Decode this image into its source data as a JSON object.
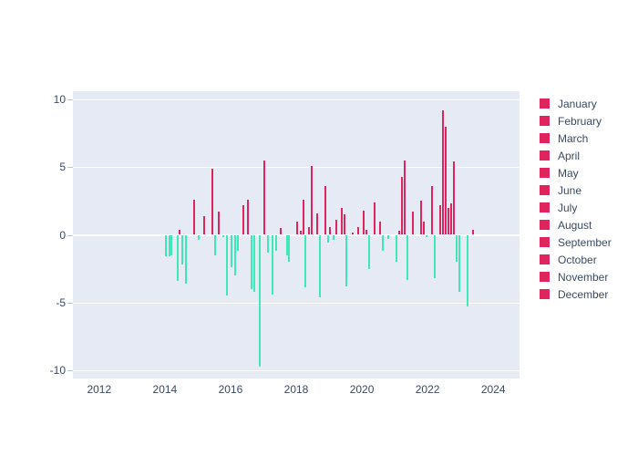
{
  "chart_data": {
    "type": "bar",
    "title": "",
    "xlabel": "",
    "ylabel": "",
    "xlim": [
      2011.2,
      2024.8
    ],
    "ylim": [
      -10.6,
      10.6
    ],
    "grid": true,
    "legend_position": "right",
    "xticks": [
      "2012",
      "2014",
      "2016",
      "2018",
      "2020",
      "2022",
      "2024"
    ],
    "xtick_values": [
      2012,
      2014,
      2016,
      2018,
      2020,
      2022,
      2024
    ],
    "yticks": [
      "10",
      "5",
      "0",
      "-5",
      "-10"
    ],
    "ytick_values": [
      10,
      5,
      0,
      -5,
      -10
    ],
    "positive_color": "#e0245e",
    "negative_color": "#3fe8b6",
    "plot_bgcolor": "#e5eaf4",
    "paper_bgcolor": "#ffffff",
    "tick_font_color": "#3b4a63",
    "series": [
      {
        "name": "January",
        "color": "#e0245e"
      },
      {
        "name": "February",
        "color": "#e0245e"
      },
      {
        "name": "March",
        "color": "#e0245e"
      },
      {
        "name": "April",
        "color": "#e0245e"
      },
      {
        "name": "May",
        "color": "#e0245e"
      },
      {
        "name": "June",
        "color": "#e0245e"
      },
      {
        "name": "July",
        "color": "#e0245e"
      },
      {
        "name": "August",
        "color": "#e0245e"
      },
      {
        "name": "September",
        "color": "#e0245e"
      },
      {
        "name": "October",
        "color": "#e0245e"
      },
      {
        "name": "November",
        "color": "#e0245e"
      },
      {
        "name": "December",
        "color": "#e0245e"
      }
    ],
    "x": [
      2014.04,
      2014.13,
      2014.21,
      2014.29,
      2014.38,
      2014.46,
      2014.54,
      2014.63,
      2014.71,
      2014.79,
      2014.88,
      2014.96,
      2015.04,
      2015.13,
      2015.21,
      2015.29,
      2015.38,
      2015.46,
      2015.54,
      2015.63,
      2015.71,
      2015.79,
      2015.88,
      2015.96,
      2016.04,
      2016.13,
      2016.21,
      2016.29,
      2016.38,
      2016.46,
      2016.54,
      2016.63,
      2016.71,
      2016.79,
      2016.88,
      2016.96,
      2017.04,
      2017.13,
      2017.21,
      2017.29,
      2017.38,
      2017.46,
      2017.54,
      2017.63,
      2017.71,
      2017.79,
      2017.88,
      2017.96,
      2018.04,
      2018.13,
      2018.21,
      2018.29,
      2018.38,
      2018.46,
      2018.54,
      2018.63,
      2018.71,
      2018.79,
      2018.88,
      2018.96,
      2019.04,
      2019.13,
      2019.21,
      2019.29,
      2019.38,
      2019.46,
      2019.54,
      2019.63,
      2019.71,
      2019.79,
      2019.88,
      2019.96,
      2020.04,
      2020.13,
      2020.21,
      2020.29,
      2020.38,
      2020.46,
      2020.54,
      2020.63,
      2020.71,
      2020.79,
      2020.88,
      2020.96,
      2021.04,
      2021.13,
      2021.21,
      2021.29,
      2021.38,
      2021.46,
      2021.54,
      2021.63,
      2021.71,
      2021.79,
      2021.88,
      2021.96,
      2022.04,
      2022.13,
      2022.21,
      2022.29,
      2022.38,
      2022.46,
      2022.54,
      2022.63,
      2022.71,
      2022.79,
      2022.88,
      2022.96,
      2023.04,
      2023.13,
      2023.21,
      2023.29,
      2023.38,
      2023.46
    ],
    "values": [
      -1.6,
      -1.6,
      -1.5,
      0.0,
      -3.4,
      0.4,
      -2.2,
      -3.6,
      0.0,
      0.0,
      2.6,
      0.0,
      -0.4,
      0.0,
      1.4,
      0.0,
      0.0,
      4.9,
      -1.5,
      1.7,
      0.0,
      -0.2,
      -4.5,
      0.0,
      -2.4,
      -3.0,
      -1.2,
      0.0,
      2.2,
      0.0,
      2.6,
      -4.0,
      -4.2,
      0.0,
      -9.7,
      0.0,
      5.5,
      -1.3,
      0.0,
      -4.4,
      -1.2,
      0.0,
      0.5,
      0.0,
      -1.5,
      -2.0,
      0.0,
      0.0,
      1.0,
      0.3,
      2.6,
      -3.9,
      0.6,
      5.1,
      0.0,
      1.6,
      -4.6,
      0.0,
      3.6,
      -0.6,
      0.6,
      -0.4,
      1.1,
      0.0,
      2.0,
      1.5,
      -3.8,
      0.0,
      0.2,
      0.0,
      0.6,
      0.0,
      1.8,
      0.4,
      -2.5,
      0.0,
      2.4,
      0.0,
      1.0,
      -1.2,
      0.0,
      -0.3,
      0.0,
      0.0,
      -2.0,
      0.3,
      4.3,
      5.5,
      -3.3,
      0.0,
      1.7,
      0.0,
      0.0,
      2.5,
      1.0,
      -0.2,
      0.0,
      3.6,
      -3.2,
      0.0,
      2.2,
      9.2,
      8.0,
      2.0,
      2.3,
      5.4,
      -2.0,
      -4.2,
      0.0,
      0.0,
      -5.3,
      0.0,
      0.4,
      0.0
    ]
  },
  "legend": {
    "items": [
      {
        "label": "January"
      },
      {
        "label": "February"
      },
      {
        "label": "March"
      },
      {
        "label": "April"
      },
      {
        "label": "May"
      },
      {
        "label": "June"
      },
      {
        "label": "July"
      },
      {
        "label": "August"
      },
      {
        "label": "September"
      },
      {
        "label": "October"
      },
      {
        "label": "November"
      },
      {
        "label": "December"
      }
    ]
  }
}
